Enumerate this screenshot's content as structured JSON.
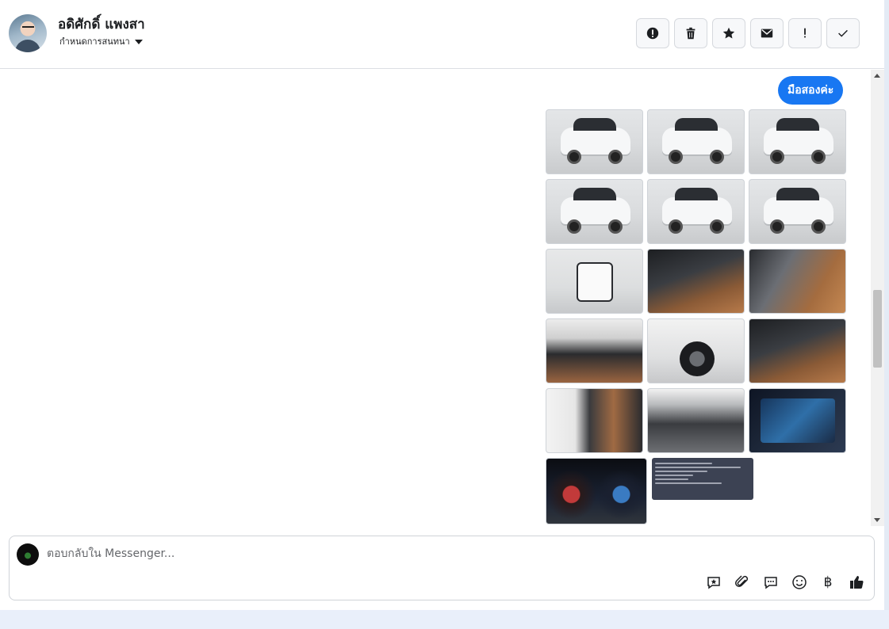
{
  "contact": {
    "name": "อดิศักดิ์ แพงสา",
    "subtitle": "กำหนดการสนทนา"
  },
  "header_actions": [
    {
      "name": "report-icon"
    },
    {
      "name": "trash-icon"
    },
    {
      "name": "star-icon"
    },
    {
      "name": "envelope-icon"
    },
    {
      "name": "exclamation-icon"
    },
    {
      "name": "check-icon"
    }
  ],
  "message": {
    "text": "มือสองค่ะ",
    "bubble_color": "#1877f2"
  },
  "attachments": [
    {
      "type": "car-photo",
      "view": "front-left"
    },
    {
      "type": "car-photo",
      "view": "rear"
    },
    {
      "type": "car-photo",
      "view": "rear-straight"
    },
    {
      "type": "car-photo",
      "view": "rear-left"
    },
    {
      "type": "car-photo",
      "view": "side"
    },
    {
      "type": "car-photo",
      "view": "side-right"
    },
    {
      "type": "car-photo",
      "view": "open-trunk"
    },
    {
      "type": "car-photo",
      "view": "dashboard-steering"
    },
    {
      "type": "car-photo",
      "view": "driver-seat"
    },
    {
      "type": "car-photo",
      "view": "dashboard-wide"
    },
    {
      "type": "car-photo",
      "view": "wheel"
    },
    {
      "type": "car-photo",
      "view": "gear-shifter"
    },
    {
      "type": "car-photo",
      "view": "door-panel"
    },
    {
      "type": "car-photo",
      "view": "engine-bay"
    },
    {
      "type": "car-photo",
      "view": "infotainment-screen"
    },
    {
      "type": "car-photo",
      "view": "instrument-cluster"
    },
    {
      "type": "spec-card",
      "view": "text-details"
    }
  ],
  "composer": {
    "placeholder": "ตอบกลับใน Messenger...",
    "tools": [
      "saved-reply-icon",
      "attachment-icon",
      "chat-bubble-icon",
      "emoji-icon",
      "baht-icon",
      "thumbs-up-icon"
    ]
  },
  "colors": {
    "accent": "#1877f2",
    "text": "#1c1e21"
  }
}
